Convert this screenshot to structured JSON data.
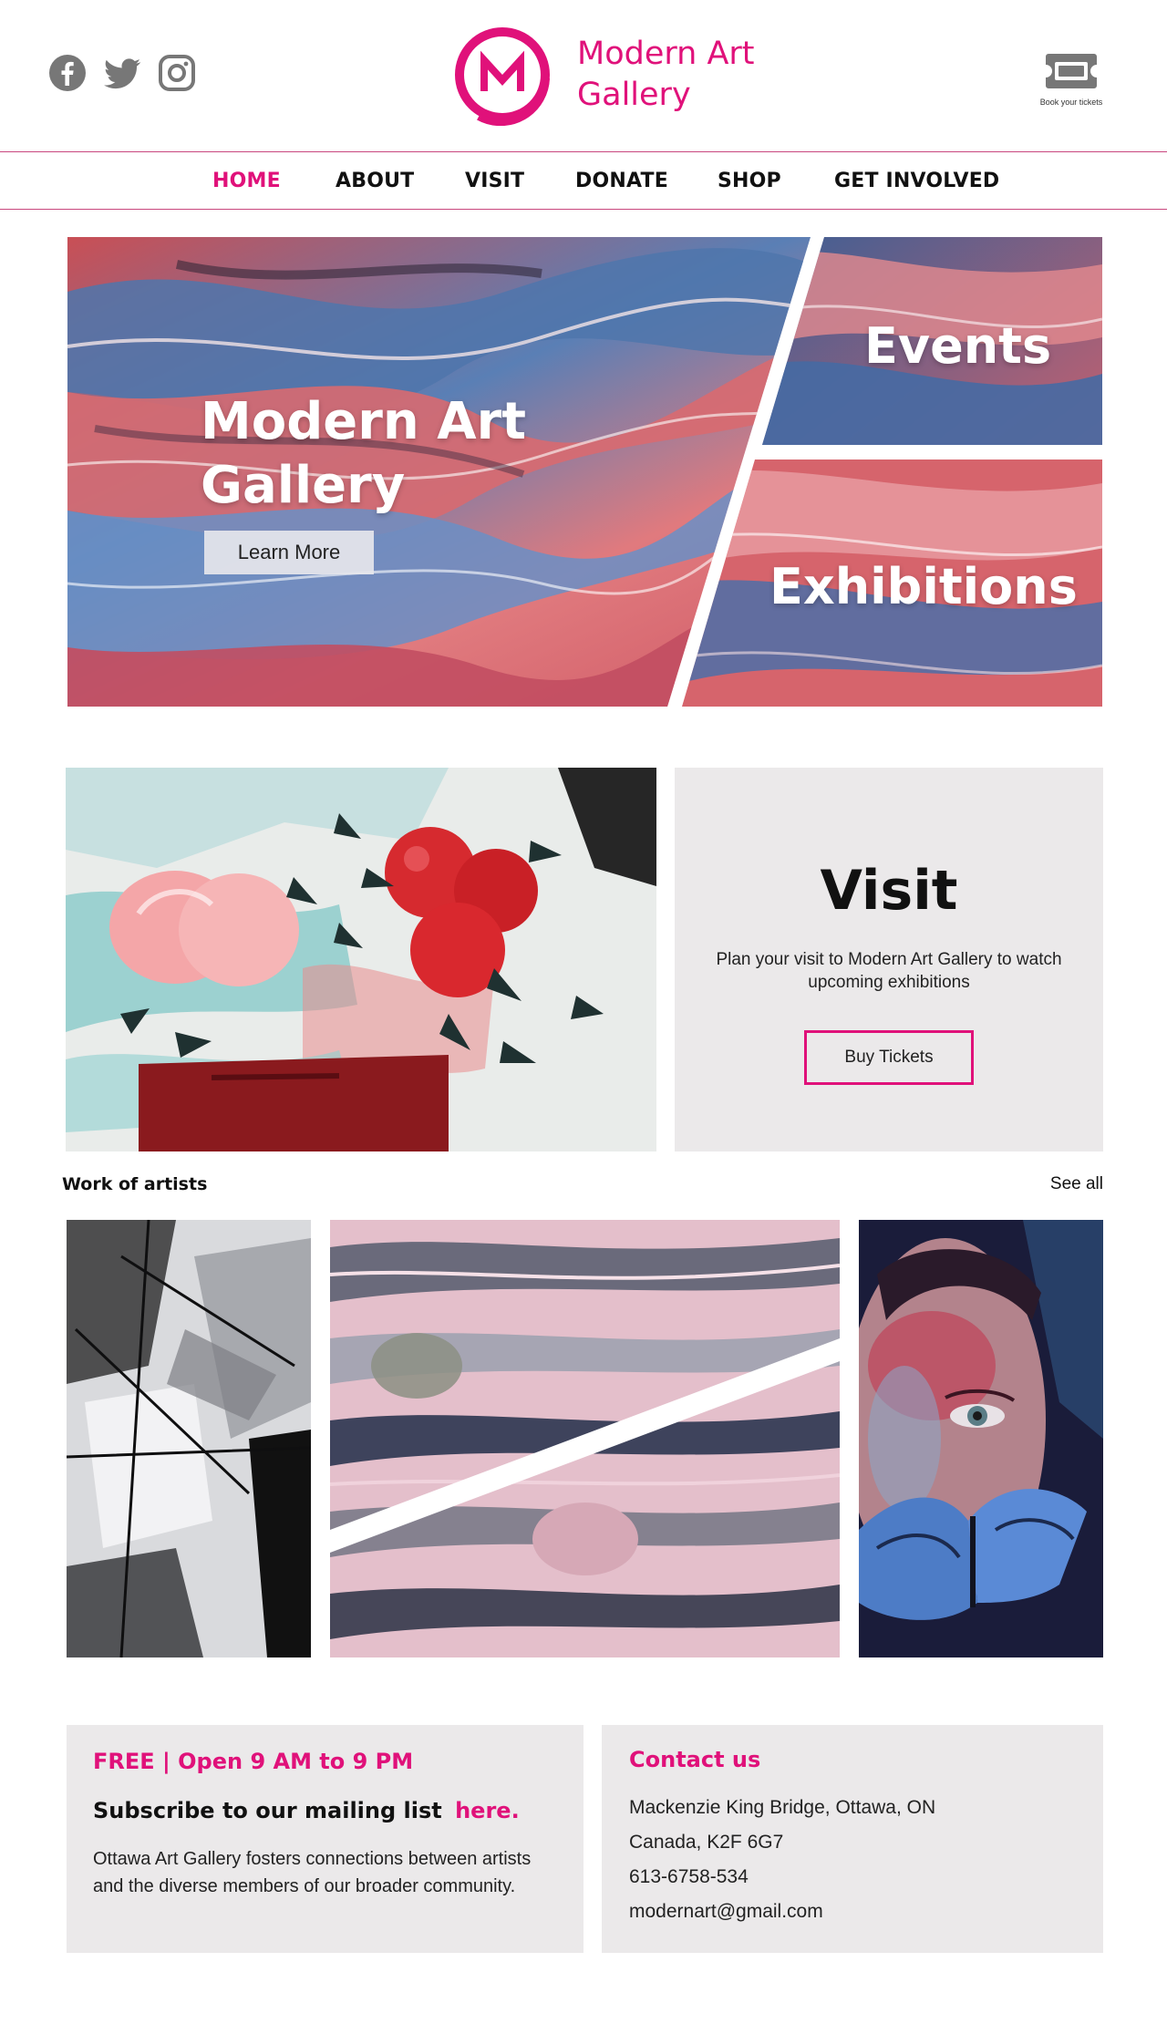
{
  "brand": {
    "name_line1": "Modern Art",
    "name_line2": "Gallery",
    "logo_letter": "M",
    "accent_color": "#e0117a"
  },
  "header": {
    "social_icons": [
      "facebook-icon",
      "twitter-icon",
      "instagram-icon"
    ],
    "tickets_label": "Book your tickets",
    "tickets_icon": "ticket-icon"
  },
  "nav": {
    "items": [
      {
        "label": "HOME",
        "active": true
      },
      {
        "label": "ABOUT",
        "active": false
      },
      {
        "label": "VISIT",
        "active": false
      },
      {
        "label": "DONATE",
        "active": false
      },
      {
        "label": "SHOP",
        "active": false
      },
      {
        "label": "GET INVOLVED",
        "active": false
      }
    ]
  },
  "hero": {
    "title_line1": "Modern Art",
    "title_line2": "Gallery",
    "button_label": "Learn More",
    "events_label": "Events",
    "exhibitions_label": "Exhibitions"
  },
  "visit": {
    "title": "Visit",
    "description": "Plan your visit to Modern Art Gallery to watch upcoming exhibitions",
    "button_label": "Buy Tickets"
  },
  "artists": {
    "title": "Work of artists",
    "see_all": "See all"
  },
  "info": {
    "hours": "FREE | Open 9 AM to 9 PM",
    "subscribe_text": "Subscribe to our mailing list",
    "subscribe_link": "here.",
    "about": "Ottawa Art Gallery fosters connections between artists and the diverse members of our broader community."
  },
  "contact": {
    "title": "Contact us",
    "address_line1": "Mackenzie King Bridge, Ottawa, ON",
    "address_line2": "Canada, K2F 6G7",
    "phone": "613-6758-534",
    "email": "modernart@gmail.com"
  }
}
